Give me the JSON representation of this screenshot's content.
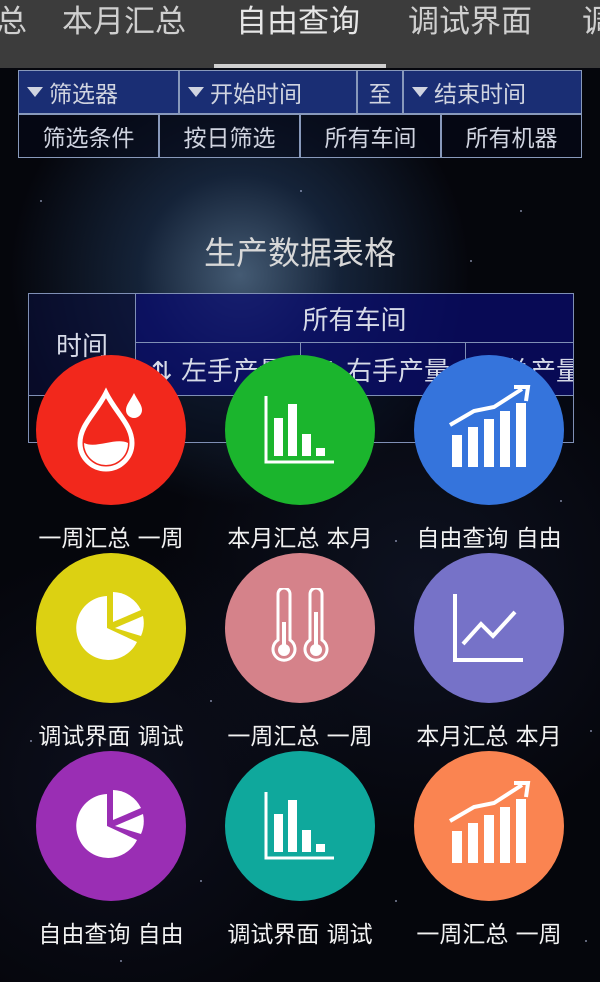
{
  "tabs": [
    {
      "label": "总"
    },
    {
      "label": "本月汇总"
    },
    {
      "label": "自由查询"
    },
    {
      "label": "调试界面"
    },
    {
      "label": "调"
    }
  ],
  "filter": {
    "selector": "筛选器",
    "start_time": "开始时间",
    "to": "至",
    "end_time": "结束时间",
    "condition": "筛选条件",
    "by_day": "按日筛选",
    "all_workshops": "所有车间",
    "all_machines": "所有机器"
  },
  "table": {
    "title": "生产数据表格",
    "time_header": "时间",
    "group_header": "所有车间",
    "columns": [
      "⇅ 左手产量",
      "⇅ 右手产量",
      "⇅ 总产量"
    ]
  },
  "grid": [
    {
      "label": "一周汇总  一周",
      "icon": "water-drop-icon",
      "color": "#f2281c"
    },
    {
      "label": "本月汇总  本月",
      "icon": "bar-chart-icon",
      "color": "#1bb52d"
    },
    {
      "label": "自由查询  自由",
      "icon": "growth-chart-icon",
      "color": "#3574dc"
    },
    {
      "label": "调试界面  调试",
      "icon": "pie-chart-icon",
      "color": "#dcd112"
    },
    {
      "label": "一周汇总  一周",
      "icon": "thermometer-icon",
      "color": "#d5828a"
    },
    {
      "label": "本月汇总  本月",
      "icon": "line-chart-icon",
      "color": "#7672c8"
    },
    {
      "label": "自由查询  自由",
      "icon": "pie-chart-icon",
      "color": "#9a2eb4"
    },
    {
      "label": "调试界面  调试",
      "icon": "bar-chart-icon",
      "color": "#0fa89c"
    },
    {
      "label": "一周汇总  一周",
      "icon": "growth-chart-icon",
      "color": "#fa8451"
    }
  ]
}
